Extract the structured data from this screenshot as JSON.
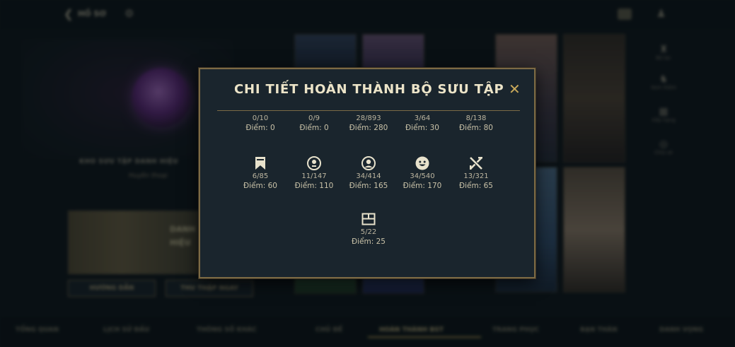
{
  "background": {
    "back_label": "HỒ SƠ",
    "hero_title": "KHO SƯU TẬP DANH HIỆU",
    "hero_subtitle": "Huyền thoại",
    "banner_line1": "DANH",
    "banner_line2": "HIỆU",
    "buttons": [
      "HƯỚNG DẪN",
      "THU THẬP NGAY"
    ],
    "side_items": [
      "Bộ lọc",
      "Xem thêm",
      "Xếp hạng",
      "Chia sẻ"
    ],
    "tabs": [
      "TỔNG QUAN",
      "LỊCH SỬ ĐẤU",
      "THÔNG SỐ KHÁC",
      "CHỦ ĐỀ",
      "HOÀN THÀNH BST",
      "TRANG PHỤC",
      "BẠN THÂN",
      "DANH VỌNG"
    ],
    "active_tab_index": 4
  },
  "modal": {
    "title": "CHI TIẾT HOÀN THÀNH BỘ SƯU TẬP",
    "close_icon": "close-icon",
    "stats": [
      {
        "icon": "",
        "count": "0/10",
        "points": "Điểm: 0"
      },
      {
        "icon": "",
        "count": "0/9",
        "points": "Điểm: 0"
      },
      {
        "icon": "",
        "count": "28/893",
        "points": "Điểm: 280"
      },
      {
        "icon": "",
        "count": "3/64",
        "points": "Điểm: 30"
      },
      {
        "icon": "",
        "count": "8/138",
        "points": "Điểm: 80"
      },
      {
        "icon": "bookmark-icon",
        "count": "6/85",
        "points": "Điểm: 60"
      },
      {
        "icon": "face-circle-icon",
        "count": "11/147",
        "points": "Điểm: 110"
      },
      {
        "icon": "avatar-frame-icon",
        "count": "34/414",
        "points": "Điểm: 165"
      },
      {
        "icon": "emote-icon",
        "count": "34/540",
        "points": "Điểm: 170"
      },
      {
        "icon": "crossed-swords-icon",
        "count": "13/321",
        "points": "Điểm: 65"
      },
      {
        "icon": "board-layout-icon",
        "count": "5/22",
        "points": "Điểm: 25"
      }
    ]
  },
  "colors": {
    "accent_gold": "#c9a95a",
    "modal_bg": "#1a252d",
    "modal_border": "#7c6a45",
    "title_text": "#ece4c8"
  }
}
